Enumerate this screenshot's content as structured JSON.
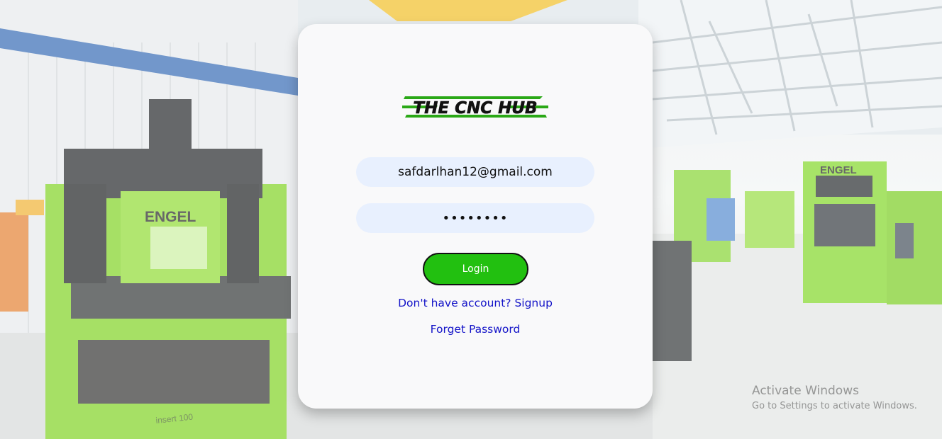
{
  "background": {
    "machine_brand": "ENGEL",
    "machine_model": "insert 100",
    "accent_color": "#8fd92d"
  },
  "login": {
    "logo_text": "THE CNC HUB",
    "email_value": "safdarlhan12@gmail.com",
    "password_value": "••••••••",
    "login_label": "Login",
    "signup_link": "Don't have account? Signup",
    "forget_link": "Forget Password",
    "button_color": "#22c010",
    "field_color": "#e8f0fe"
  },
  "watermark": {
    "title": "Activate Windows",
    "subtitle": "Go to Settings to activate Windows."
  }
}
